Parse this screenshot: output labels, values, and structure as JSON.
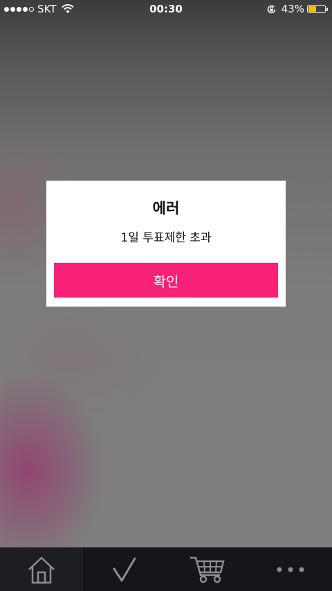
{
  "status_bar": {
    "carrier": "SKT",
    "time": "00:30",
    "battery_percent": "43%",
    "battery_level": 0.43,
    "signal_bars": 4,
    "icons": [
      "signal-dots-icon",
      "wifi-icon",
      "rotation-lock-icon",
      "battery-icon"
    ]
  },
  "dialog": {
    "title": "에러",
    "message": "1일 투표제한 초과",
    "confirm_label": "확인"
  },
  "tab_bar": {
    "items": [
      {
        "name": "home",
        "icon": "home-icon",
        "active": true
      },
      {
        "name": "vote",
        "icon": "checkmark-icon",
        "active": false
      },
      {
        "name": "cart",
        "icon": "cart-icon",
        "active": false
      },
      {
        "name": "more",
        "icon": "more-dots-icon",
        "active": false
      }
    ]
  },
  "colors": {
    "accent": "#f72177",
    "battery": "#f2c200",
    "tab_bar_bg": "#15161a"
  }
}
